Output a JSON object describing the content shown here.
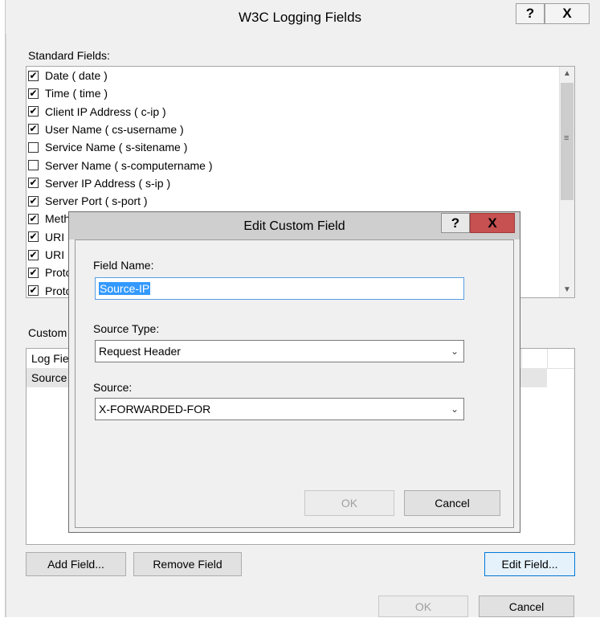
{
  "outer_dialog": {
    "title": "W3C Logging Fields",
    "help_label": "?",
    "close_label": "X",
    "standard_fields_label": "Standard Fields:",
    "standard_fields": [
      {
        "label": "Date ( date )",
        "checked": true
      },
      {
        "label": "Time ( time )",
        "checked": true
      },
      {
        "label": "Client IP Address ( c-ip )",
        "checked": true
      },
      {
        "label": "User Name ( cs-username )",
        "checked": true
      },
      {
        "label": "Service Name ( s-sitename )",
        "checked": false
      },
      {
        "label": "Server Name ( s-computername )",
        "checked": false
      },
      {
        "label": "Server IP Address ( s-ip )",
        "checked": true
      },
      {
        "label": "Server Port ( s-port )",
        "checked": true
      },
      {
        "label": "Meth",
        "checked": true
      },
      {
        "label": "URI S",
        "checked": true
      },
      {
        "label": "URI (",
        "checked": true
      },
      {
        "label": "Proto",
        "checked": true
      },
      {
        "label": "Proto",
        "checked": true
      }
    ],
    "scroll_up_icon": "chevron-up-icon",
    "scroll_down_icon": "chevron-down-icon",
    "custom_fields_label": "Custom",
    "custom_columns": [
      "Log Fie"
    ],
    "custom_rows": [
      "Source"
    ],
    "add_field_label": "Add Field...",
    "remove_field_label": "Remove Field",
    "edit_field_label": "Edit Field...",
    "ok_label": "OK",
    "cancel_label": "Cancel"
  },
  "edit_dialog": {
    "title": "Edit Custom Field",
    "help_label": "?",
    "close_label": "X",
    "field_name_label": "Field Name:",
    "field_name_value": "Source-IP",
    "source_type_label": "Source Type:",
    "source_type_value": "Request Header",
    "source_label": "Source:",
    "source_value": "X-FORWARDED-FOR",
    "ok_label": "OK",
    "cancel_label": "Cancel",
    "close_button_color": "#c75050"
  }
}
